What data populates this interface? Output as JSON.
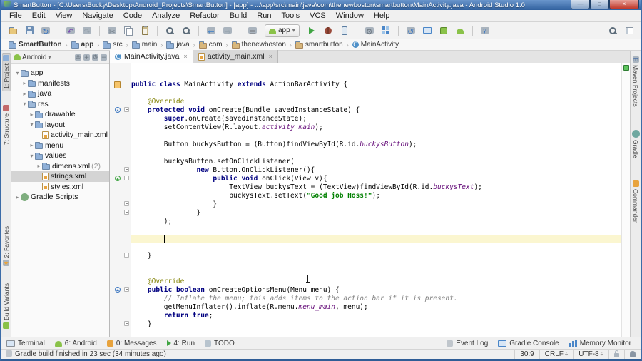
{
  "window": {
    "title": "SmartButton - [C:\\Users\\Bucky\\Desktop\\Android_Projects\\SmartButton] - [app] - ...\\app\\src\\main\\java\\com\\thenewboston\\smartbutton\\MainActivity.java - Android Studio 1.0",
    "controls": [
      {
        "name": "minimize",
        "glyph": "—"
      },
      {
        "name": "maximize",
        "glyph": "□"
      },
      {
        "name": "close",
        "glyph": "×"
      }
    ]
  },
  "menu": {
    "items": [
      "File",
      "Edit",
      "View",
      "Navigate",
      "Code",
      "Analyze",
      "Refactor",
      "Build",
      "Run",
      "Tools",
      "VCS",
      "Window",
      "Help"
    ]
  },
  "toolbar": {
    "run_config_label": "app",
    "icons_left": [
      {
        "name": "open"
      },
      {
        "name": "save"
      },
      {
        "name": "sync"
      },
      "sep",
      {
        "name": "undo"
      },
      {
        "name": "redo"
      },
      "sep",
      {
        "name": "cut"
      },
      {
        "name": "copy"
      },
      {
        "name": "paste"
      },
      "sep",
      {
        "name": "find"
      },
      {
        "name": "replace"
      },
      "sep",
      {
        "name": "back"
      },
      {
        "name": "forward"
      },
      "sep",
      {
        "name": "sort-lines"
      },
      {
        "type": "run-config"
      },
      {
        "name": "run"
      },
      {
        "name": "debug"
      },
      {
        "name": "attach-debugger"
      },
      "sep",
      {
        "name": "settings"
      },
      {
        "name": "project-structure"
      },
      "sep",
      {
        "name": "sync-gradle"
      },
      {
        "name": "monitor"
      },
      {
        "name": "sdk-manager"
      },
      {
        "name": "avd-manager"
      },
      "sep",
      {
        "name": "help"
      }
    ],
    "icons_right": [
      {
        "name": "search"
      },
      {
        "name": "user-panel"
      }
    ]
  },
  "breadcrumbs": [
    {
      "label": "SmartButton",
      "icon": "folder",
      "bold": true
    },
    {
      "label": "app",
      "icon": "folder",
      "bold": true
    },
    {
      "label": "src",
      "icon": "folder"
    },
    {
      "label": "main",
      "icon": "folder"
    },
    {
      "label": "java",
      "icon": "folder"
    },
    {
      "label": "com",
      "icon": "package"
    },
    {
      "label": "thenewboston",
      "icon": "package"
    },
    {
      "label": "smartbutton",
      "icon": "package"
    },
    {
      "label": "MainActivity",
      "icon": "class"
    }
  ],
  "left_sidebar": {
    "top": [
      {
        "label": "1: Project",
        "icon": "project-tool",
        "active": true
      },
      {
        "label": "7: Structure",
        "icon": "structure-tool",
        "active": false
      }
    ],
    "bottom": [
      {
        "label": "2: Favorites",
        "icon": "favorites",
        "active": false
      },
      {
        "label": "Build Variants",
        "icon": "build-variants",
        "active": false
      }
    ]
  },
  "project_panel": {
    "mode_selector": "Android",
    "header_icons": [
      "collapse-all",
      "scroll-from-source",
      "settings-gear",
      "hide-panel"
    ],
    "tree": [
      {
        "label": "app",
        "depth": 0,
        "arrow": "open",
        "icon": "module"
      },
      {
        "label": "manifests",
        "depth": 1,
        "arrow": "closed",
        "icon": "folder"
      },
      {
        "label": "java",
        "depth": 1,
        "arrow": "closed",
        "icon": "folder"
      },
      {
        "label": "res",
        "depth": 1,
        "arrow": "open",
        "icon": "module"
      },
      {
        "label": "drawable",
        "depth": 2,
        "arrow": "closed",
        "icon": "folder"
      },
      {
        "label": "layout",
        "depth": 2,
        "arrow": "open",
        "icon": "folder"
      },
      {
        "label": "activity_main.xml",
        "depth": 3,
        "arrow": "none",
        "icon": "xml"
      },
      {
        "label": "menu",
        "depth": 2,
        "arrow": "closed",
        "icon": "folder"
      },
      {
        "label": "values",
        "depth": 2,
        "arrow": "open",
        "icon": "folder"
      },
      {
        "label": "dimens.xml",
        "suffix": " (2)",
        "depth": 3,
        "arrow": "closed",
        "icon": "folder"
      },
      {
        "label": "strings.xml",
        "depth": 3,
        "arrow": "none",
        "icon": "xml",
        "selected": true
      },
      {
        "label": "styles.xml",
        "depth": 3,
        "arrow": "none",
        "icon": "xml"
      },
      {
        "label": "Gradle Scripts",
        "depth": 0,
        "arrow": "closed",
        "icon": "gradle-file"
      }
    ]
  },
  "editor": {
    "tabs": [
      {
        "label": "MainActivity.java",
        "icon": "class",
        "close": "×",
        "active": true
      },
      {
        "label": "activity_main.xml",
        "icon": "xml",
        "close": "×",
        "active": false
      }
    ],
    "code_lines": [
      {
        "segs": []
      },
      {
        "segs": []
      },
      {
        "segs": [
          [
            "k",
            "public"
          ],
          [
            "p",
            " "
          ],
          [
            "k",
            "class"
          ],
          [
            "p",
            " MainActivity "
          ],
          [
            "k",
            "extends"
          ],
          [
            "p",
            " ActionBarActivity {"
          ]
        ]
      },
      {
        "segs": []
      },
      {
        "segs": [
          [
            "a",
            "    @Override"
          ]
        ]
      },
      {
        "segs": [
          [
            "p",
            "    "
          ],
          [
            "k",
            "protected"
          ],
          [
            "p",
            " "
          ],
          [
            "k",
            "void"
          ],
          [
            "p",
            " onCreate(Bundle savedInstanceState) {"
          ]
        ]
      },
      {
        "segs": [
          [
            "p",
            "        "
          ],
          [
            "k",
            "super"
          ],
          [
            "p",
            ".onCreate(savedInstanceState);"
          ]
        ]
      },
      {
        "segs": [
          [
            "p",
            "        setContentView(R.layout."
          ],
          [
            "f",
            "activity_main"
          ],
          [
            "p",
            ");"
          ]
        ]
      },
      {
        "segs": []
      },
      {
        "segs": [
          [
            "p",
            "        Button buckysButton = (Button)findViewById(R.id."
          ],
          [
            "f",
            "buckysButton"
          ],
          [
            "p",
            ");"
          ]
        ]
      },
      {
        "segs": []
      },
      {
        "segs": [
          [
            "p",
            "        buckysButton.setOnClickListener("
          ]
        ]
      },
      {
        "segs": [
          [
            "p",
            "                "
          ],
          [
            "k",
            "new"
          ],
          [
            "p",
            " Button.OnClickListener(){"
          ]
        ]
      },
      {
        "segs": [
          [
            "p",
            "                    "
          ],
          [
            "k",
            "public"
          ],
          [
            "p",
            " "
          ],
          [
            "k",
            "void"
          ],
          [
            "p",
            " onClick(View v){"
          ]
        ]
      },
      {
        "segs": [
          [
            "p",
            "                        TextView buckysText = (TextView)findViewById(R.id."
          ],
          [
            "f",
            "buckysText"
          ],
          [
            "p",
            ");"
          ]
        ]
      },
      {
        "segs": [
          [
            "p",
            "                        buckysText.setText("
          ],
          [
            "s",
            "\"Good job Hoss!\""
          ],
          [
            "p",
            ");"
          ]
        ]
      },
      {
        "segs": [
          [
            "p",
            "                    }"
          ]
        ]
      },
      {
        "segs": [
          [
            "p",
            "                }"
          ]
        ]
      },
      {
        "segs": [
          [
            "p",
            "        );"
          ]
        ]
      },
      {
        "segs": []
      },
      {
        "segs": [],
        "highlight": true,
        "caret_col": 8
      },
      {
        "segs": []
      },
      {
        "segs": [
          [
            "p",
            "    }"
          ]
        ]
      },
      {
        "segs": []
      },
      {
        "segs": []
      },
      {
        "segs": [
          [
            "a",
            "    @Override"
          ]
        ]
      },
      {
        "segs": [
          [
            "p",
            "    "
          ],
          [
            "k",
            "public"
          ],
          [
            "p",
            " "
          ],
          [
            "k",
            "boolean"
          ],
          [
            "p",
            " onCreateOptionsMenu(Menu menu) {"
          ]
        ]
      },
      {
        "segs": [
          [
            "c",
            "        // Inflate the menu; this adds items to the action bar if it is present."
          ]
        ]
      },
      {
        "segs": [
          [
            "p",
            "        getMenuInflater().inflate(R.menu."
          ],
          [
            "f",
            "menu_main"
          ],
          [
            "p",
            ", menu);"
          ]
        ]
      },
      {
        "segs": [
          [
            "p",
            "        "
          ],
          [
            "k",
            "return"
          ],
          [
            "p",
            " "
          ],
          [
            "k",
            "true"
          ],
          [
            "p",
            ";"
          ]
        ]
      },
      {
        "segs": [
          [
            "p",
            "    }"
          ]
        ]
      },
      {
        "segs": []
      }
    ],
    "gutter_markers": [
      {
        "line": 2,
        "type": "xml"
      },
      {
        "line": 5,
        "type": "override"
      },
      {
        "line": 5,
        "type": "fold"
      },
      {
        "line": 12,
        "type": "fold"
      },
      {
        "line": 13,
        "type": "implement"
      },
      {
        "line": 13,
        "type": "fold"
      },
      {
        "line": 16,
        "type": "fold-end"
      },
      {
        "line": 17,
        "type": "fold-end"
      },
      {
        "line": 22,
        "type": "fold-end"
      },
      {
        "line": 26,
        "type": "override"
      },
      {
        "line": 26,
        "type": "fold"
      },
      {
        "line": 30,
        "type": "fold-end"
      }
    ],
    "inspection_color": "#5ec45e"
  },
  "right_sidebar": [
    {
      "label": "Maven Projects",
      "icon": "maven"
    },
    {
      "label": "Gradle",
      "icon": "gradle-tab"
    },
    {
      "label": "Commander",
      "icon": "commander"
    }
  ],
  "tool_buttons": {
    "left": [
      {
        "label": "Terminal",
        "icon": "terminal"
      },
      {
        "label": "6: Android",
        "icon": "android"
      },
      {
        "label": "0: Messages",
        "icon": "messages"
      },
      {
        "label": "4: Run",
        "icon": "run-tool"
      },
      {
        "label": "TODO",
        "icon": "todo"
      }
    ],
    "right": [
      {
        "label": "Event Log",
        "icon": "event-log"
      },
      {
        "label": "Gradle Console",
        "icon": "gradle-console"
      },
      {
        "label": "Memory Monitor",
        "icon": "memory"
      }
    ]
  },
  "status_bar": {
    "message": "Gradle build finished in 23 sec (34 minutes ago)",
    "caret_position": "30:9",
    "line_separator": "CRLF",
    "encoding": "UTF-8",
    "spinner_glyph": "÷"
  },
  "ui_glyphs": {
    "chevron": "›",
    "dropdown": "▾",
    "tree_open": "▾",
    "tree_closed": "▸"
  },
  "icon_defs": {
    "open": {
      "shape": "folder",
      "bg": "#e8c87c",
      "border": "#b5935a"
    },
    "save": {
      "shape": "save"
    },
    "sync": {
      "glyph": "↻",
      "fg": "#3b76c0"
    },
    "undo": {
      "glyph": "↶",
      "fg": "#7a4fb0"
    },
    "redo": {
      "glyph": "↷",
      "fg": "#98a4ae"
    },
    "cut": {
      "glyph": "✂",
      "fg": "#6f7a84"
    },
    "copy": {
      "shape": "copy"
    },
    "paste": {
      "shape": "paste"
    },
    "find": {
      "shape": "mag"
    },
    "replace": {
      "shape": "mag"
    },
    "back": {
      "glyph": "←",
      "fg": "#4a86c8"
    },
    "forward": {
      "glyph": "→",
      "fg": "#9aa7b0"
    },
    "sort-lines": {
      "glyph": "≡",
      "fg": "#8a9097"
    },
    "run": {
      "shape": "play"
    },
    "debug": {
      "shape": "bug"
    },
    "attach-debugger": {
      "shape": "phone"
    },
    "settings": {
      "glyph": "⚙",
      "fg": "#6f7a84"
    },
    "project-structure": {
      "shape": "grid"
    },
    "sync-gradle": {
      "glyph": "↺",
      "fg": "#3b76c0"
    },
    "monitor": {
      "shape": "monitor"
    },
    "sdk-manager": {
      "shape": "android-box"
    },
    "avd-manager": {
      "shape": "android"
    },
    "help": {
      "glyph": "?",
      "fg": "#3b76c0"
    },
    "search": {
      "shape": "mag"
    },
    "user-panel": {
      "shape": "panel"
    },
    "android-head": {
      "shape": "android"
    },
    "folder": {
      "shape": "folder"
    },
    "package": {
      "shape": "folder",
      "bg": "#d8b77c",
      "border": "#a8875c"
    },
    "class": {
      "shape": "circle",
      "glyph": "C"
    },
    "xml": {
      "shape": "file"
    },
    "module": {
      "shape": "folder",
      "bg": "#9db8d8"
    },
    "gradle-file": {
      "shape": "circle",
      "bg": "#7fae7f"
    },
    "terminal": {
      "shape": "monitor",
      "bg": "#8a9097"
    },
    "android": {
      "shape": "android"
    },
    "messages": {
      "shape": "sq",
      "bg": "#e8a33d"
    },
    "run-tool": {
      "shape": "play",
      "size": "sm"
    },
    "todo": {
      "shape": "sq",
      "bg": "#b8c4ce"
    },
    "event-log": {
      "shape": "sq",
      "bg": "#c0c6cc"
    },
    "gradle-console": {
      "shape": "monitor",
      "bg": "#4a86c8"
    },
    "memory": {
      "shape": "bars"
    },
    "maven": {
      "glyph": "m",
      "fg": "#4a6fa5"
    },
    "gradle-tab": {
      "shape": "circle",
      "bg": "#6fa8a0"
    },
    "commander": {
      "shape": "sq",
      "bg": "#e8a33d"
    },
    "project-tool": {
      "shape": "sq",
      "bg": "#8fb0d8"
    },
    "structure-tool": {
      "shape": "sq",
      "bg": "#c46a6a"
    },
    "favorites": {
      "glyph": "★",
      "fg": "#e8a33d"
    },
    "build-variants": {
      "shape": "sq",
      "bg": "#8ac249"
    },
    "collapse-all": {
      "glyph": "⊗",
      "fg": "#6f7a84"
    },
    "scroll-from-source": {
      "glyph": "+",
      "fg": "#6f7a84"
    },
    "settings-gear": {
      "glyph": "⚙",
      "fg": "#6f7a84"
    },
    "hide-panel": {
      "glyph": "−",
      "fg": "#6f7a84"
    },
    "android-studio-logo": {
      "shape": "as"
    },
    "background-tasks": {
      "shape": "sq",
      "bg": "#c0c6cc"
    },
    "lock": {
      "shape": "lock"
    },
    "hector": {
      "shape": "hector"
    }
  }
}
